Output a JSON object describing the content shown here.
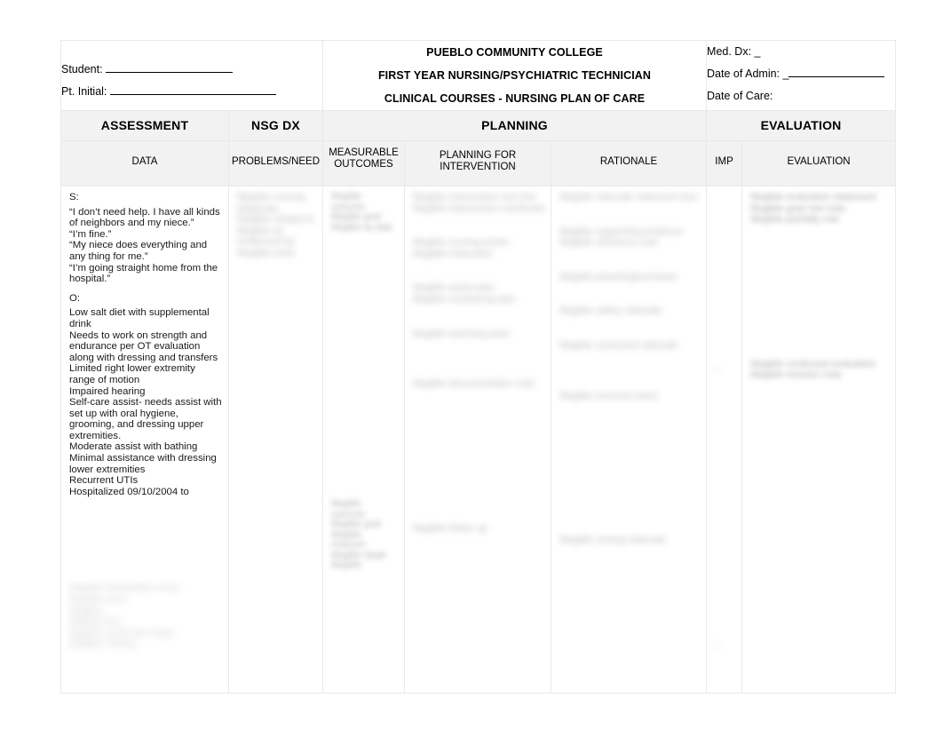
{
  "document": {
    "title": "Pueblo Community College - Nursing Plan of Care"
  },
  "header": {
    "student_label": "Student:",
    "pt_initial_label": "Pt. Initial:",
    "institution_line1": "PUEBLO COMMUNITY COLLEGE",
    "institution_line2": "FIRST YEAR NURSING/PSYCHIATRIC TECHNICIAN",
    "institution_line3": "CLINICAL COURSES - NURSING PLAN OF CARE",
    "med_dx_label": "Med. Dx:",
    "med_dx_value": "_",
    "date_admin_label": "Date of Admin:",
    "date_admin_value": "_",
    "date_care_label": "Date of Care:",
    "date_care_value": ""
  },
  "columns": {
    "group": {
      "assessment": "ASSESSMENT",
      "nsg_dx": "NSG DX",
      "planning": "PLANNING",
      "evaluation": "EVALUATION"
    },
    "sub": {
      "data": "DATA",
      "problems_need": "PROBLEMS/NEED",
      "measurable_outcomes": "MEASURABLE\nOUTCOMES",
      "measurable_outcomes_line1": "MEASURABLE",
      "measurable_outcomes_line2": "OUTCOMES",
      "planning_for_intervention_line1": "PLANNING FOR",
      "planning_for_intervention_line2": "INTERVENTION",
      "rationale": "RATIONALE",
      "imp": "IMP",
      "evaluation": "EVALUATION"
    }
  },
  "body": {
    "data": {
      "subjective_label": "S:",
      "subjective": [
        "“I don’t need help. I have all kinds of neighbors and my niece.”",
        "“I’m fine.”",
        "“My niece does everything and any thing for me.”",
        "“I’m going straight home from the hospital.”"
      ],
      "objective_label": "O:",
      "objective": [
        "Low salt diet with supplemental drink",
        "Needs to work on strength and endurance per OT evaluation along with dressing and transfers",
        "Limited right lower extremity range of motion",
        "Impaired hearing",
        "Self-care assist- needs assist with set up with oral hygiene, grooming, and dressing upper extremities.",
        "Moderate assist with bathing",
        "Minimal assistance with dressing lower extremities",
        "Recurrent UTIs",
        "Hospitalized 09/10/2004 to"
      ],
      "redacted": [
        "Illegible handwritten entry",
        "Illegible entry",
        "Illegible",
        "Illegible text",
        "Illegible continued notes",
        "Illegible closing"
      ]
    },
    "problems_need": {
      "redacted": [
        "Illegible nursing diagnosis",
        "Illegible related to",
        "Illegible as evidenced by",
        "Illegible entry"
      ]
    },
    "measurable_outcomes": {
      "redacted_top": [
        "Illegible outcome",
        "Illegible goal",
        "Illegible by date"
      ],
      "redacted_bottom": [
        "Illegible outcome",
        "Illegible goal",
        "Illegible measure",
        "Illegible target",
        "Illegible"
      ]
    },
    "planning_for_intervention": {
      "redacted": [
        "Illegible intervention text line",
        "Illegible intervention continued",
        "Illegible nursing action",
        "Illegible instruction",
        "Illegible assist plan",
        "Illegible monitoring plan",
        "Illegible teaching point",
        "Illegible documentation note",
        "Illegible follow up"
      ]
    },
    "rationale": {
      "redacted": [
        "Illegible rationale statement text",
        "Illegible supporting evidence",
        "Illegible reference note",
        "Illegible physiological basis",
        "Illegible safety rationale",
        "Illegible continued rationale",
        "Illegible outcome basis",
        "Illegible closing rationale"
      ]
    },
    "imp": {
      "redacted": [
        "x",
        "x"
      ]
    },
    "evaluation": {
      "redacted": [
        "Illegible evaluation statement",
        "Illegible goal met note",
        "Illegible partially met",
        "Illegible continued evaluation",
        "Illegible revision note"
      ]
    }
  },
  "colors": {
    "header_band": "#f2f2f2",
    "border": "#e9e9e9",
    "text": "#000000",
    "blur_text": "#6e6e6e"
  }
}
